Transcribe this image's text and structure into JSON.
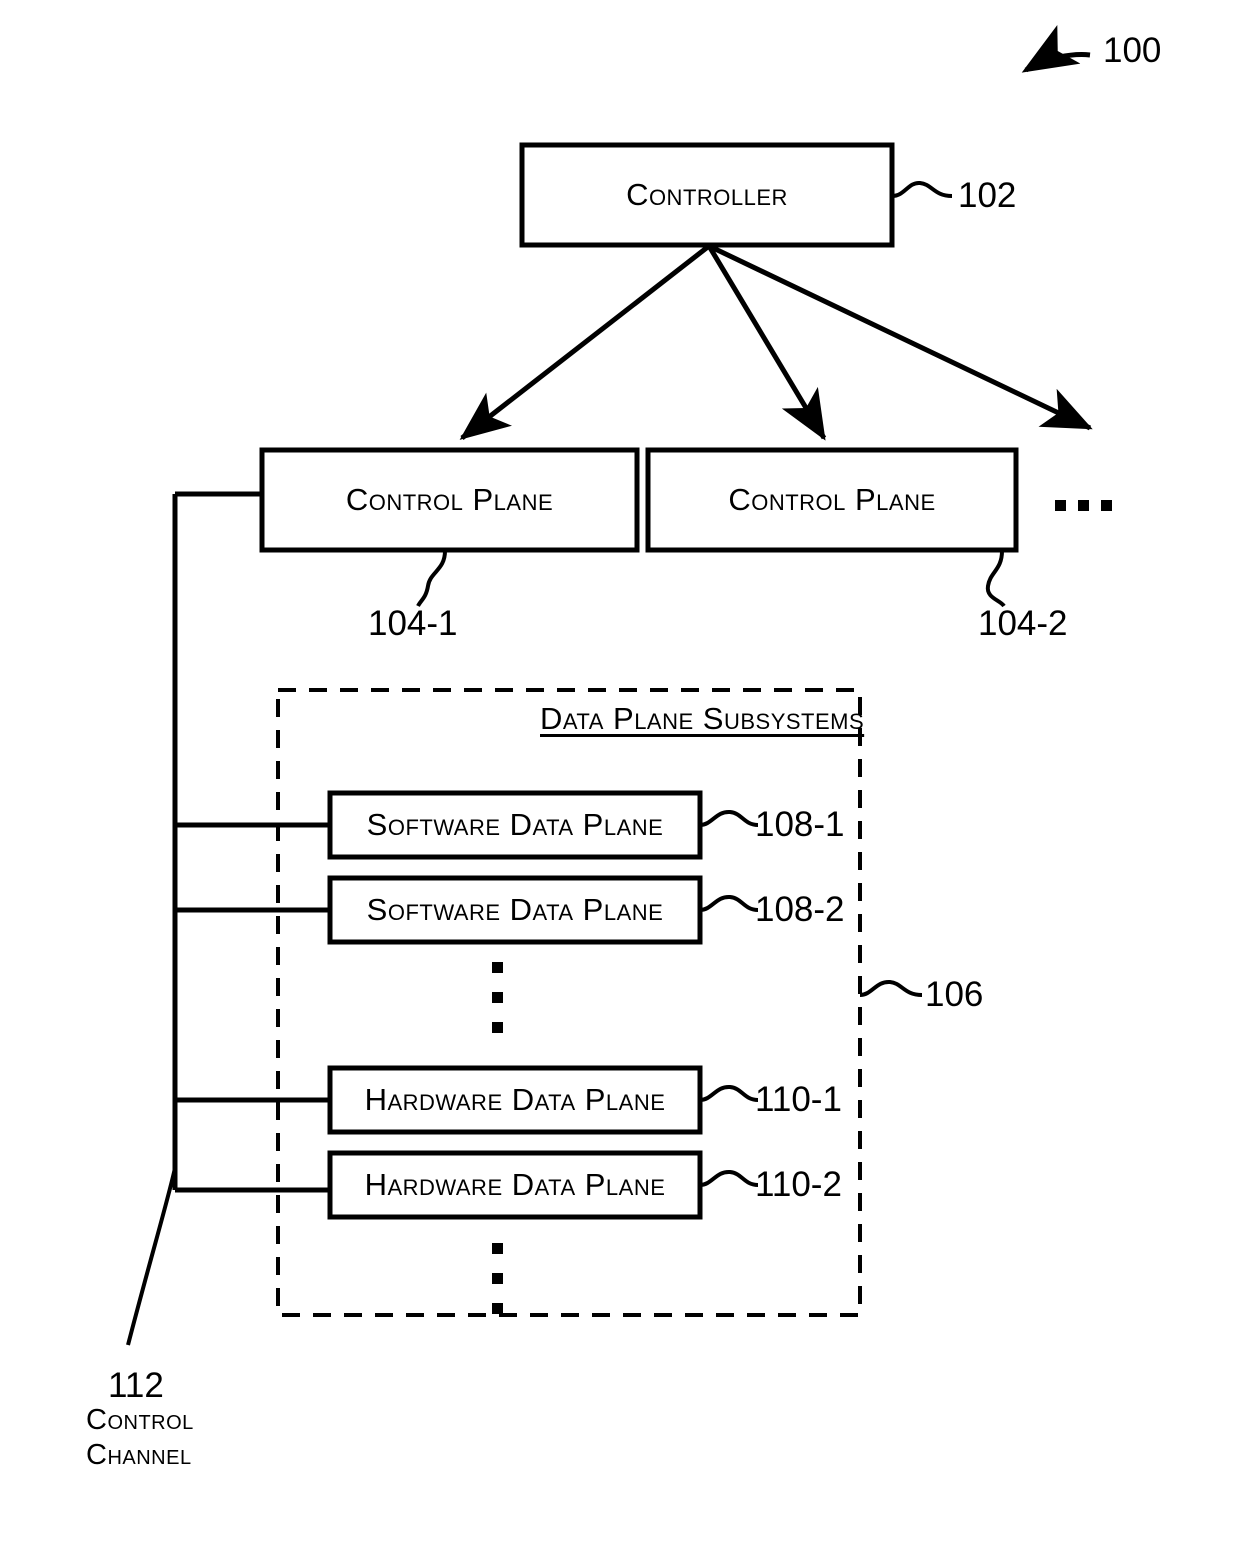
{
  "figure": {
    "label": "100",
    "type": "patent-block-diagram"
  },
  "controller": {
    "title": "Controller",
    "ref": "102"
  },
  "control_planes": [
    {
      "title": "Control Plane",
      "ref": "104-1"
    },
    {
      "title": "Control Plane",
      "ref": "104-2"
    }
  ],
  "control_plane_ellipsis": "▪ ▪ ▪",
  "data_plane_subsystems": {
    "title": "Data Plane Subsystems",
    "ref": "106",
    "software_planes": [
      {
        "title": "Software Data Plane",
        "ref": "108-1"
      },
      {
        "title": "Software Data Plane",
        "ref": "108-2"
      }
    ],
    "hardware_planes": [
      {
        "title": "Hardware Data Plane",
        "ref": "110-1"
      },
      {
        "title": "Hardware Data Plane",
        "ref": "110-2"
      }
    ]
  },
  "control_channel": {
    "ref": "112",
    "line1": "Control",
    "line2": "Channel"
  },
  "colors": {
    "stroke": "#000000",
    "background": "#ffffff"
  }
}
